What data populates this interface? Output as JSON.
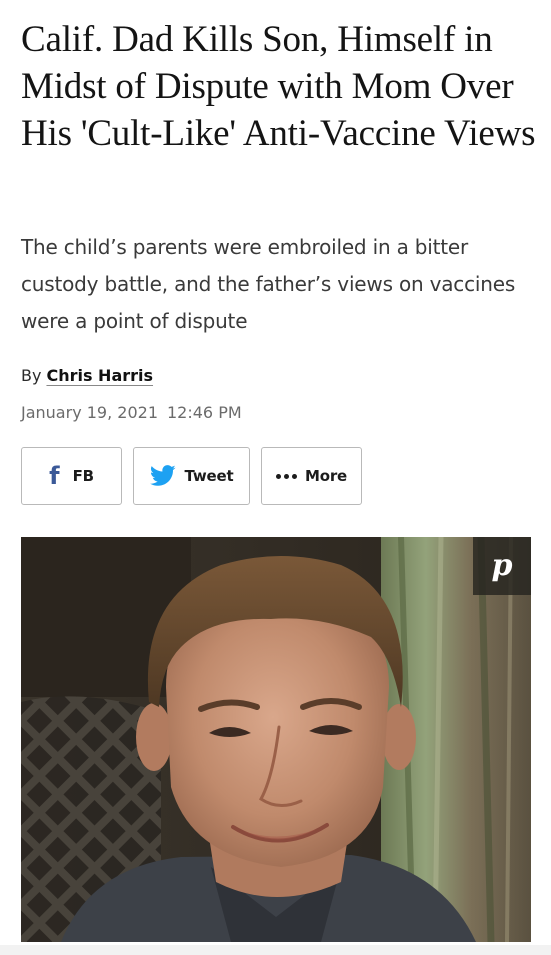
{
  "article": {
    "headline": "Calif. Dad Kills Son, Himself in Midst of Dispute with Mom Over His 'Cult-Like' Anti-Vaccine Views",
    "dek": "The child’s parents were embroiled in a bitter custody battle, and the father’s views on vaccines were a point of dispute",
    "byline": {
      "prefix": "By",
      "author": "Chris Harris"
    },
    "date": "January 19, 2021",
    "time": "12:46 PM"
  },
  "share": {
    "facebook": {
      "icon": "facebook-icon",
      "glyph": "f",
      "label": "FB"
    },
    "twitter": {
      "icon": "twitter-bird-icon",
      "label": "Tweet"
    },
    "more": {
      "icon": "ellipsis-icon",
      "label": "More"
    }
  },
  "photo": {
    "pin": {
      "icon": "pinterest-icon",
      "glyph": "p"
    }
  },
  "colors": {
    "facebook": "#3b5998",
    "twitter": "#1da1f2",
    "button_border": "#b9b9b9",
    "date_text": "#6b6b6b"
  }
}
